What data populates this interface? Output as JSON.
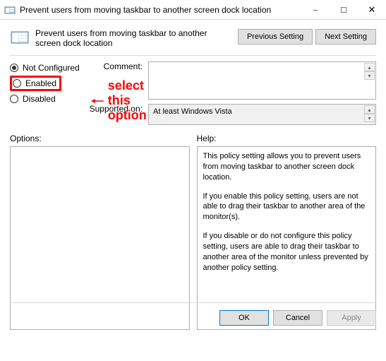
{
  "titlebar": {
    "title": "Prevent users from moving taskbar to another screen dock location"
  },
  "header": {
    "title": "Prevent users from moving taskbar to another screen dock location",
    "prev_label": "Previous Setting",
    "next_label": "Next Setting"
  },
  "radios": {
    "not_configured": "Not Configured",
    "enabled": "Enabled",
    "disabled": "Disabled",
    "selected": "not_configured"
  },
  "labels": {
    "comment": "Comment:",
    "supported": "Supported on:",
    "options": "Options:",
    "help": "Help:"
  },
  "supported_text": "At least Windows Vista",
  "help_text": {
    "p1": "This policy setting allows you to prevent users from moving taskbar to another screen dock location.",
    "p2": "If you enable this policy setting, users are not able to drag their taskbar to another area of the monitor(s).",
    "p3": "If you disable or do not configure this policy setting, users are able to drag their taskbar to another area of the monitor unless prevented by another policy setting."
  },
  "buttons": {
    "ok": "OK",
    "cancel": "Cancel",
    "apply": "Apply"
  },
  "annotation": {
    "text": "select this option"
  }
}
